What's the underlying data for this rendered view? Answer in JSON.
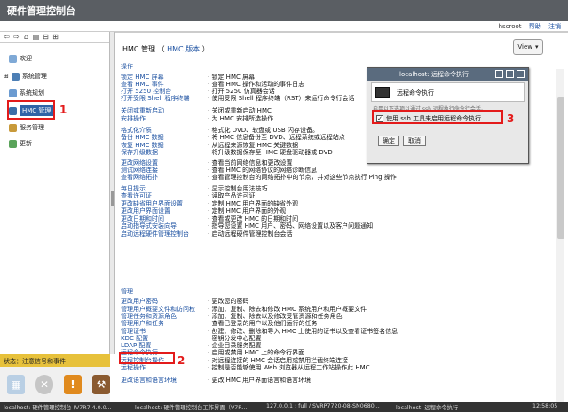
{
  "window": {
    "title": "硬件管理控制台"
  },
  "topbar": {
    "user": "hscroot",
    "help": "帮助",
    "logout": "注销"
  },
  "nav": {
    "items": [
      {
        "label": "欢迎",
        "icon": "welcome-icon"
      },
      {
        "label": "系统管理",
        "icon": "systems-management-icon"
      },
      {
        "label": "系统规划",
        "icon": "system-plans-icon"
      },
      {
        "label": "HMC 管理",
        "icon": "hmc-management-icon",
        "selected": true
      },
      {
        "label": "服务管理",
        "icon": "service-management-icon"
      },
      {
        "label": "更新",
        "icon": "updates-icon"
      }
    ]
  },
  "content": {
    "title": "HMC 管理",
    "version_link": "HMC 版本",
    "view_button": "View",
    "sections": [
      {
        "heading": "操作",
        "rows": [
          {
            "link": "锁定 HMC 屏幕",
            "desc": "· 锁定 HMC 屏幕"
          },
          {
            "link": "查看 HMC 事件",
            "desc": "· 查看 HMC 操作和活动的事件日志"
          },
          {
            "link": "打开 5250 控制台",
            "desc": "· 打开 5250 仿真器会话"
          },
          {
            "link": "打开受限 Shell 程序终端",
            "desc": "· 使用受限 Shell 程序终端（RST）来运行命令行会话"
          },
          {
            "link": "关闭或重新启动",
            "desc": "· 关闭或重新启动 HMC"
          },
          {
            "link": "安排操作",
            "desc": "· 为 HMC 安排所选操作"
          },
          {
            "link": "格式化介质",
            "desc": "· 格式化 DVD、软盘或 USB 闪存设备。"
          },
          {
            "link": "备份 HMC 数据",
            "desc": "· 将 HMC 信息备份至 DVD、远程系统或远程站点"
          },
          {
            "link": "恢复 HMC 数据",
            "desc": "· 从远程来源恢复 HMC 关键数据"
          },
          {
            "link": "保存升级数据",
            "desc": "· 将升级数据保存至 HMC 硬盘驱动器或 DVD"
          },
          {
            "link": "更改网络设置",
            "desc": "· 查看当前网络信息和更改设置"
          },
          {
            "link": "测试网络连接",
            "desc": "· 查看 HMC 的网络协议的网络诊断信息"
          },
          {
            "link": "查看网络拓扑",
            "desc": "· 查看管理控制台的网络拓扑中的节点，并对这些节点执行 Ping 操作"
          },
          {
            "link": "每日提示",
            "desc": "· 显示控制台用法技巧"
          },
          {
            "link": "查看许可证",
            "desc": "· 读取产品许可证"
          },
          {
            "link": "更改缺省用户界面设置",
            "desc": "· 定制 HMC 用户界面的缺省外观"
          },
          {
            "link": "更改用户界面设置",
            "desc": "· 定制 HMC 用户界面的外观"
          },
          {
            "link": "更改日期和时间",
            "desc": "· 查看或更改 HMC 的日期和时间"
          },
          {
            "link": "启动指导式安装向导",
            "desc": "· 指导您设置 HMC 用户、密码、网络设置以及客户问题通知"
          },
          {
            "link": "启动远程硬件管理控制台",
            "desc": "· 启动远程硬件管理控制台会话"
          }
        ]
      },
      {
        "heading": "管理",
        "rows": [
          {
            "link": "更改用户密码",
            "desc": "· 更改您的密码"
          },
          {
            "link": "管理用户概要文件和访问权",
            "desc": "· 添加、复制、除去和修改 HMC 系统用户和用户概要文件"
          },
          {
            "link": "管理任务和资源角色",
            "desc": "· 添加、复制、除去以及修改受管资源和任务角色"
          },
          {
            "link": "管理用户和任务",
            "desc": "· 查看已登录的用户以及他们运行的任务"
          },
          {
            "link": "管理证书",
            "desc": "· 创建、修改、删除和导入 HMC 上使用的证书以及查看证书签名信息"
          },
          {
            "link": "KDC 配置",
            "desc": "· 密钥分发中心配置"
          },
          {
            "link": "LDAP 配置",
            "desc": "· 企业目录服务配置"
          },
          {
            "link": "远程命令执行",
            "desc": "· 启用或禁用 HMC 上的命令行界面"
          },
          {
            "link": "远程控制台操作",
            "desc": "· 对远程连接的 HMC 会话启用或禁用拦截终端连接"
          },
          {
            "link": "远程操作",
            "desc": "· 控制是否能够使用 Web 浏览器从远程工作站操作此 HMC"
          },
          {
            "link": "更改语言和语言环境",
            "desc": "· 更改 HMC 用户界面语言和语言环境"
          }
        ]
      }
    ]
  },
  "status": {
    "label": "状态：注意信号和事件"
  },
  "dialog": {
    "title": "localhost: 远程命令执行",
    "header": "远程命令执行",
    "hint": "启用以下选项以通过 ssh 远程执行命令行会话。",
    "checkbox_label": "使用 ssh 工具来启用远程命令执行",
    "checked": true,
    "ok": "确定",
    "cancel": "取消"
  },
  "annotations": {
    "n1": "1",
    "n2": "2",
    "n3": "3",
    "color": "#e31b1b"
  },
  "taskbar": {
    "t1": "localhost: 硬件管理控制台 (V7R7.4.0.0...",
    "t2": "localhost: 硬件管理控制台工作界面（V7R...",
    "t3": "127.0.0.1 : full / SVRP7720-08-SN0680...",
    "t4": "localhost: 远程命令执行",
    "time": "12:58:05"
  }
}
